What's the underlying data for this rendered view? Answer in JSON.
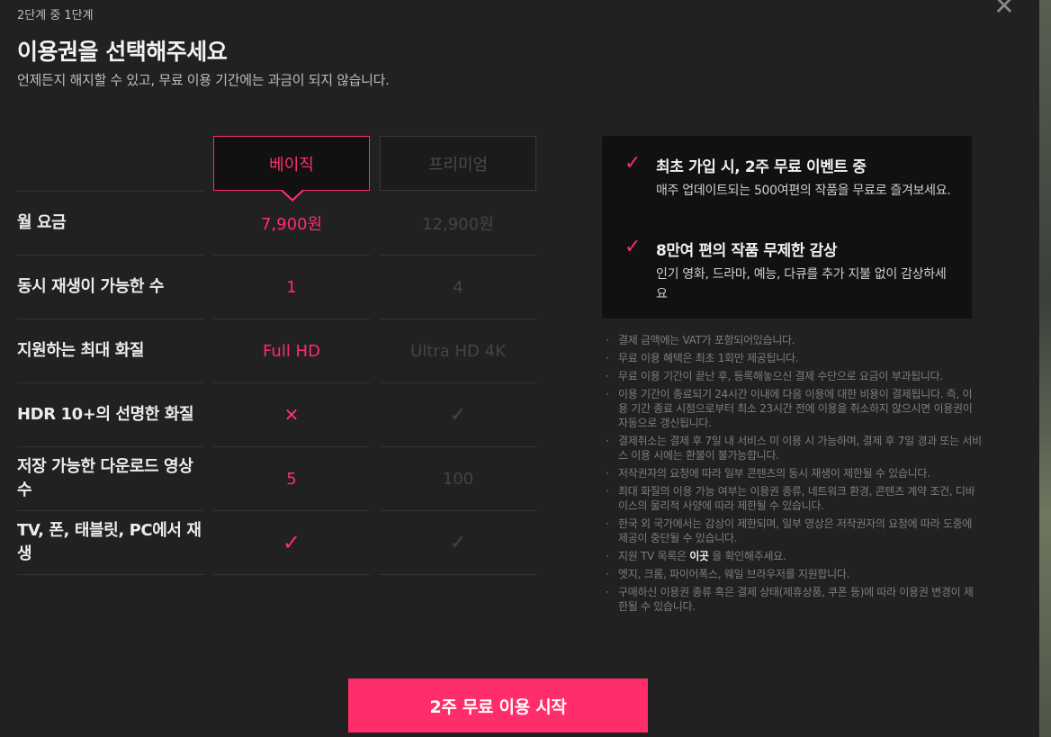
{
  "header": {
    "step": "2단계 중 1단계",
    "title": "이용권을 선택해주세요",
    "subtitle": "언제든지 해지할 수 있고, 무료 이용 기간에는 과금이 되지 않습니다.",
    "close_icon": "close-icon"
  },
  "plans": {
    "basic": "베이직",
    "premium": "프리미엄",
    "selected": "basic"
  },
  "rows": [
    {
      "label": "월 요금",
      "basic": "7,900원",
      "premium": "12,900원"
    },
    {
      "label": "동시 재생이 가능한 수",
      "basic": "1",
      "premium": "4"
    },
    {
      "label": "지원하는 최대 화질",
      "basic": "Full HD",
      "premium": "Ultra HD 4K"
    },
    {
      "label": "HDR 10+의 선명한 화질",
      "basic": "✕",
      "premium": "✓"
    },
    {
      "label": "저장 가능한 다운로드 영상 수",
      "basic": "5",
      "premium": "100"
    },
    {
      "label": "TV, 폰, 태블릿, PC에서 재생",
      "basic": "✓",
      "premium": "✓"
    }
  ],
  "promo": {
    "items": [
      {
        "title": "최초 가입 시, 2주 무료 이벤트 중",
        "desc": "매주 업데이트되는 500여편의 작품을 무료로 즐겨보세요."
      },
      {
        "title": "8만여 편의 작품 무제한 감상",
        "desc": "인기 영화, 드라마, 예능, 다큐를 추가 지불 없이 감상하세요"
      }
    ]
  },
  "notes": {
    "n1": "결제 금액에는 VAT가 포함되어있습니다.",
    "n2": "무료 이용 혜택은 최초 1회만 제공됩니다.",
    "n3": "무료 이용 기간이 끝난 후, 등록해놓으신 결제 수단으로 요금이 부과됩니다.",
    "n4": "이용 기간이 종료되기 24시간 이내에 다음 이용에 대한 비용이 결제됩니다. 즉, 이용 기간 종료 시점으로부터 최소 23시간 전에 이용을 취소하지 않으시면 이용권이 자동으로 갱신됩니다.",
    "n5": "결제취소는 결제 후 7일 내 서비스 미 이용 시 가능하며, 결제 후 7일 경과 또는 서비스 이용 시에는 환불이 불가능합니다.",
    "n6": "저작권자의 요청에 따라 일부 콘텐츠의 동시 재생이 제한될 수 있습니다.",
    "n7": "최대 화질의 이용 가능 여부는 이용권 종류, 네트워크 환경, 콘텐츠 계약 조건, 디바이스의 물리적 사양에 따라 제한될 수 있습니다.",
    "n8": "한국 외 국가에서는 감상이 제한되며, 일부 영상은 저작권자의 요청에 따라 도중에 제공이 중단될 수 있습니다.",
    "n9_pre": "지원 TV 목록은",
    "n9_link": "이곳",
    "n9_post": "을 확인해주세요.",
    "n10": "엣지, 크롬, 파이어폭스, 웨일 브라우저를 지원합니다.",
    "n11": "구매하신 이용권 종류 혹은 결제 상태(제휴상품, 쿠폰 등)에 따라 이용권 변경이 제한될 수 있습니다."
  },
  "cta": {
    "label": "2주 무료 이용 시작"
  },
  "colors": {
    "accent": "#ff2d6a",
    "background": "#212121",
    "panel": "#111111"
  }
}
